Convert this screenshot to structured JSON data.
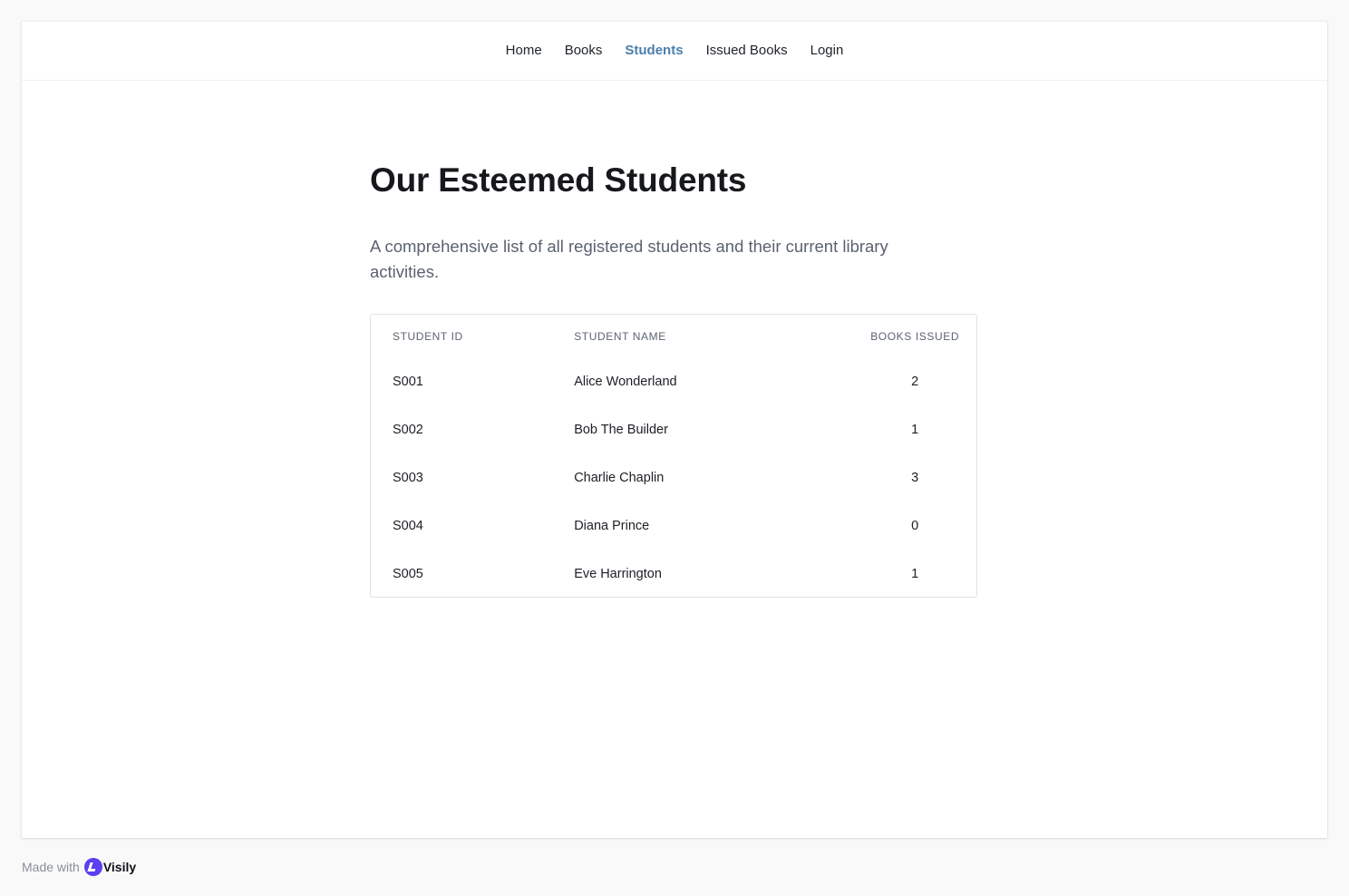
{
  "nav": {
    "items": [
      {
        "label": "Home",
        "active": false
      },
      {
        "label": "Books",
        "active": false
      },
      {
        "label": "Students",
        "active": true
      },
      {
        "label": "Issued Books",
        "active": false
      },
      {
        "label": "Login",
        "active": false
      }
    ],
    "active_color": "#4a7eab"
  },
  "page": {
    "title": "Our Esteemed Students",
    "subtitle": "A comprehensive list of all registered students and their current library activities."
  },
  "table": {
    "headers": {
      "id": "STUDENT ID",
      "name": "STUDENT NAME",
      "count": "BOOKS ISSUED"
    },
    "rows": [
      {
        "id": "S001",
        "name": "Alice Wonderland",
        "count": "2"
      },
      {
        "id": "S002",
        "name": "Bob The Builder",
        "count": "1"
      },
      {
        "id": "S003",
        "name": "Charlie Chaplin",
        "count": "3"
      },
      {
        "id": "S004",
        "name": "Diana Prince",
        "count": "0"
      },
      {
        "id": "S005",
        "name": "Eve Harrington",
        "count": "1"
      }
    ]
  },
  "footer": {
    "made_with": "Made with",
    "brand": "Visily",
    "brand_icon": "visily-logo-icon",
    "brand_color": "#5b3ff0"
  }
}
